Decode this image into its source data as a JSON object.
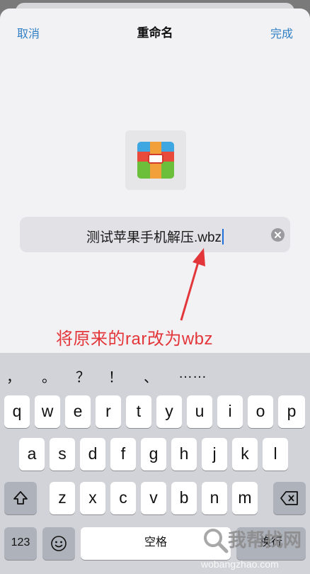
{
  "nav": {
    "cancel": "取消",
    "title": "重命名",
    "done": "完成"
  },
  "file": {
    "icon": "rar-archive-icon",
    "name": "测试苹果手机解压.wbz"
  },
  "annotation": {
    "text": "将原来的rar改为wbz",
    "color": "#e3363a"
  },
  "colors": {
    "accent": "#2f7fc5",
    "cursor": "#1e6fd6"
  },
  "keyboard": {
    "punctuation": [
      "，",
      "。",
      "？",
      "！",
      "、",
      "……"
    ],
    "row1": [
      "q",
      "w",
      "e",
      "r",
      "t",
      "y",
      "u",
      "i",
      "o",
      "p"
    ],
    "row2": [
      "a",
      "s",
      "d",
      "f",
      "g",
      "h",
      "j",
      "k",
      "l"
    ],
    "row3": [
      "z",
      "x",
      "c",
      "v",
      "b",
      "n",
      "m"
    ],
    "numbers_key": "123",
    "space_key": "空格",
    "return_key": "换行",
    "shift_icon": "shift-icon",
    "delete_icon": "backspace-icon",
    "emoji_icon": "emoji-icon"
  },
  "watermark": {
    "text": "我帮找网",
    "url": "wobangzhao.com"
  }
}
